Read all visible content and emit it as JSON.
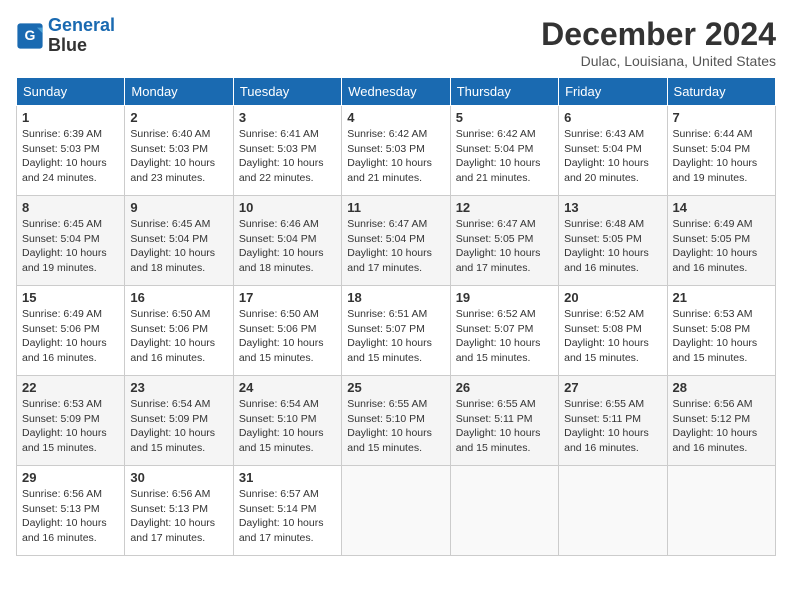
{
  "logo": {
    "line1": "General",
    "line2": "Blue"
  },
  "title": "December 2024",
  "location": "Dulac, Louisiana, United States",
  "weekdays": [
    "Sunday",
    "Monday",
    "Tuesday",
    "Wednesday",
    "Thursday",
    "Friday",
    "Saturday"
  ],
  "weeks": [
    [
      {
        "day": "1",
        "info": "Sunrise: 6:39 AM\nSunset: 5:03 PM\nDaylight: 10 hours\nand 24 minutes."
      },
      {
        "day": "2",
        "info": "Sunrise: 6:40 AM\nSunset: 5:03 PM\nDaylight: 10 hours\nand 23 minutes."
      },
      {
        "day": "3",
        "info": "Sunrise: 6:41 AM\nSunset: 5:03 PM\nDaylight: 10 hours\nand 22 minutes."
      },
      {
        "day": "4",
        "info": "Sunrise: 6:42 AM\nSunset: 5:03 PM\nDaylight: 10 hours\nand 21 minutes."
      },
      {
        "day": "5",
        "info": "Sunrise: 6:42 AM\nSunset: 5:04 PM\nDaylight: 10 hours\nand 21 minutes."
      },
      {
        "day": "6",
        "info": "Sunrise: 6:43 AM\nSunset: 5:04 PM\nDaylight: 10 hours\nand 20 minutes."
      },
      {
        "day": "7",
        "info": "Sunrise: 6:44 AM\nSunset: 5:04 PM\nDaylight: 10 hours\nand 19 minutes."
      }
    ],
    [
      {
        "day": "8",
        "info": "Sunrise: 6:45 AM\nSunset: 5:04 PM\nDaylight: 10 hours\nand 19 minutes."
      },
      {
        "day": "9",
        "info": "Sunrise: 6:45 AM\nSunset: 5:04 PM\nDaylight: 10 hours\nand 18 minutes."
      },
      {
        "day": "10",
        "info": "Sunrise: 6:46 AM\nSunset: 5:04 PM\nDaylight: 10 hours\nand 18 minutes."
      },
      {
        "day": "11",
        "info": "Sunrise: 6:47 AM\nSunset: 5:04 PM\nDaylight: 10 hours\nand 17 minutes."
      },
      {
        "day": "12",
        "info": "Sunrise: 6:47 AM\nSunset: 5:05 PM\nDaylight: 10 hours\nand 17 minutes."
      },
      {
        "day": "13",
        "info": "Sunrise: 6:48 AM\nSunset: 5:05 PM\nDaylight: 10 hours\nand 16 minutes."
      },
      {
        "day": "14",
        "info": "Sunrise: 6:49 AM\nSunset: 5:05 PM\nDaylight: 10 hours\nand 16 minutes."
      }
    ],
    [
      {
        "day": "15",
        "info": "Sunrise: 6:49 AM\nSunset: 5:06 PM\nDaylight: 10 hours\nand 16 minutes."
      },
      {
        "day": "16",
        "info": "Sunrise: 6:50 AM\nSunset: 5:06 PM\nDaylight: 10 hours\nand 16 minutes."
      },
      {
        "day": "17",
        "info": "Sunrise: 6:50 AM\nSunset: 5:06 PM\nDaylight: 10 hours\nand 15 minutes."
      },
      {
        "day": "18",
        "info": "Sunrise: 6:51 AM\nSunset: 5:07 PM\nDaylight: 10 hours\nand 15 minutes."
      },
      {
        "day": "19",
        "info": "Sunrise: 6:52 AM\nSunset: 5:07 PM\nDaylight: 10 hours\nand 15 minutes."
      },
      {
        "day": "20",
        "info": "Sunrise: 6:52 AM\nSunset: 5:08 PM\nDaylight: 10 hours\nand 15 minutes."
      },
      {
        "day": "21",
        "info": "Sunrise: 6:53 AM\nSunset: 5:08 PM\nDaylight: 10 hours\nand 15 minutes."
      }
    ],
    [
      {
        "day": "22",
        "info": "Sunrise: 6:53 AM\nSunset: 5:09 PM\nDaylight: 10 hours\nand 15 minutes."
      },
      {
        "day": "23",
        "info": "Sunrise: 6:54 AM\nSunset: 5:09 PM\nDaylight: 10 hours\nand 15 minutes."
      },
      {
        "day": "24",
        "info": "Sunrise: 6:54 AM\nSunset: 5:10 PM\nDaylight: 10 hours\nand 15 minutes."
      },
      {
        "day": "25",
        "info": "Sunrise: 6:55 AM\nSunset: 5:10 PM\nDaylight: 10 hours\nand 15 minutes."
      },
      {
        "day": "26",
        "info": "Sunrise: 6:55 AM\nSunset: 5:11 PM\nDaylight: 10 hours\nand 15 minutes."
      },
      {
        "day": "27",
        "info": "Sunrise: 6:55 AM\nSunset: 5:11 PM\nDaylight: 10 hours\nand 16 minutes."
      },
      {
        "day": "28",
        "info": "Sunrise: 6:56 AM\nSunset: 5:12 PM\nDaylight: 10 hours\nand 16 minutes."
      }
    ],
    [
      {
        "day": "29",
        "info": "Sunrise: 6:56 AM\nSunset: 5:13 PM\nDaylight: 10 hours\nand 16 minutes."
      },
      {
        "day": "30",
        "info": "Sunrise: 6:56 AM\nSunset: 5:13 PM\nDaylight: 10 hours\nand 17 minutes."
      },
      {
        "day": "31",
        "info": "Sunrise: 6:57 AM\nSunset: 5:14 PM\nDaylight: 10 hours\nand 17 minutes."
      },
      {
        "day": "",
        "info": ""
      },
      {
        "day": "",
        "info": ""
      },
      {
        "day": "",
        "info": ""
      },
      {
        "day": "",
        "info": ""
      }
    ]
  ]
}
